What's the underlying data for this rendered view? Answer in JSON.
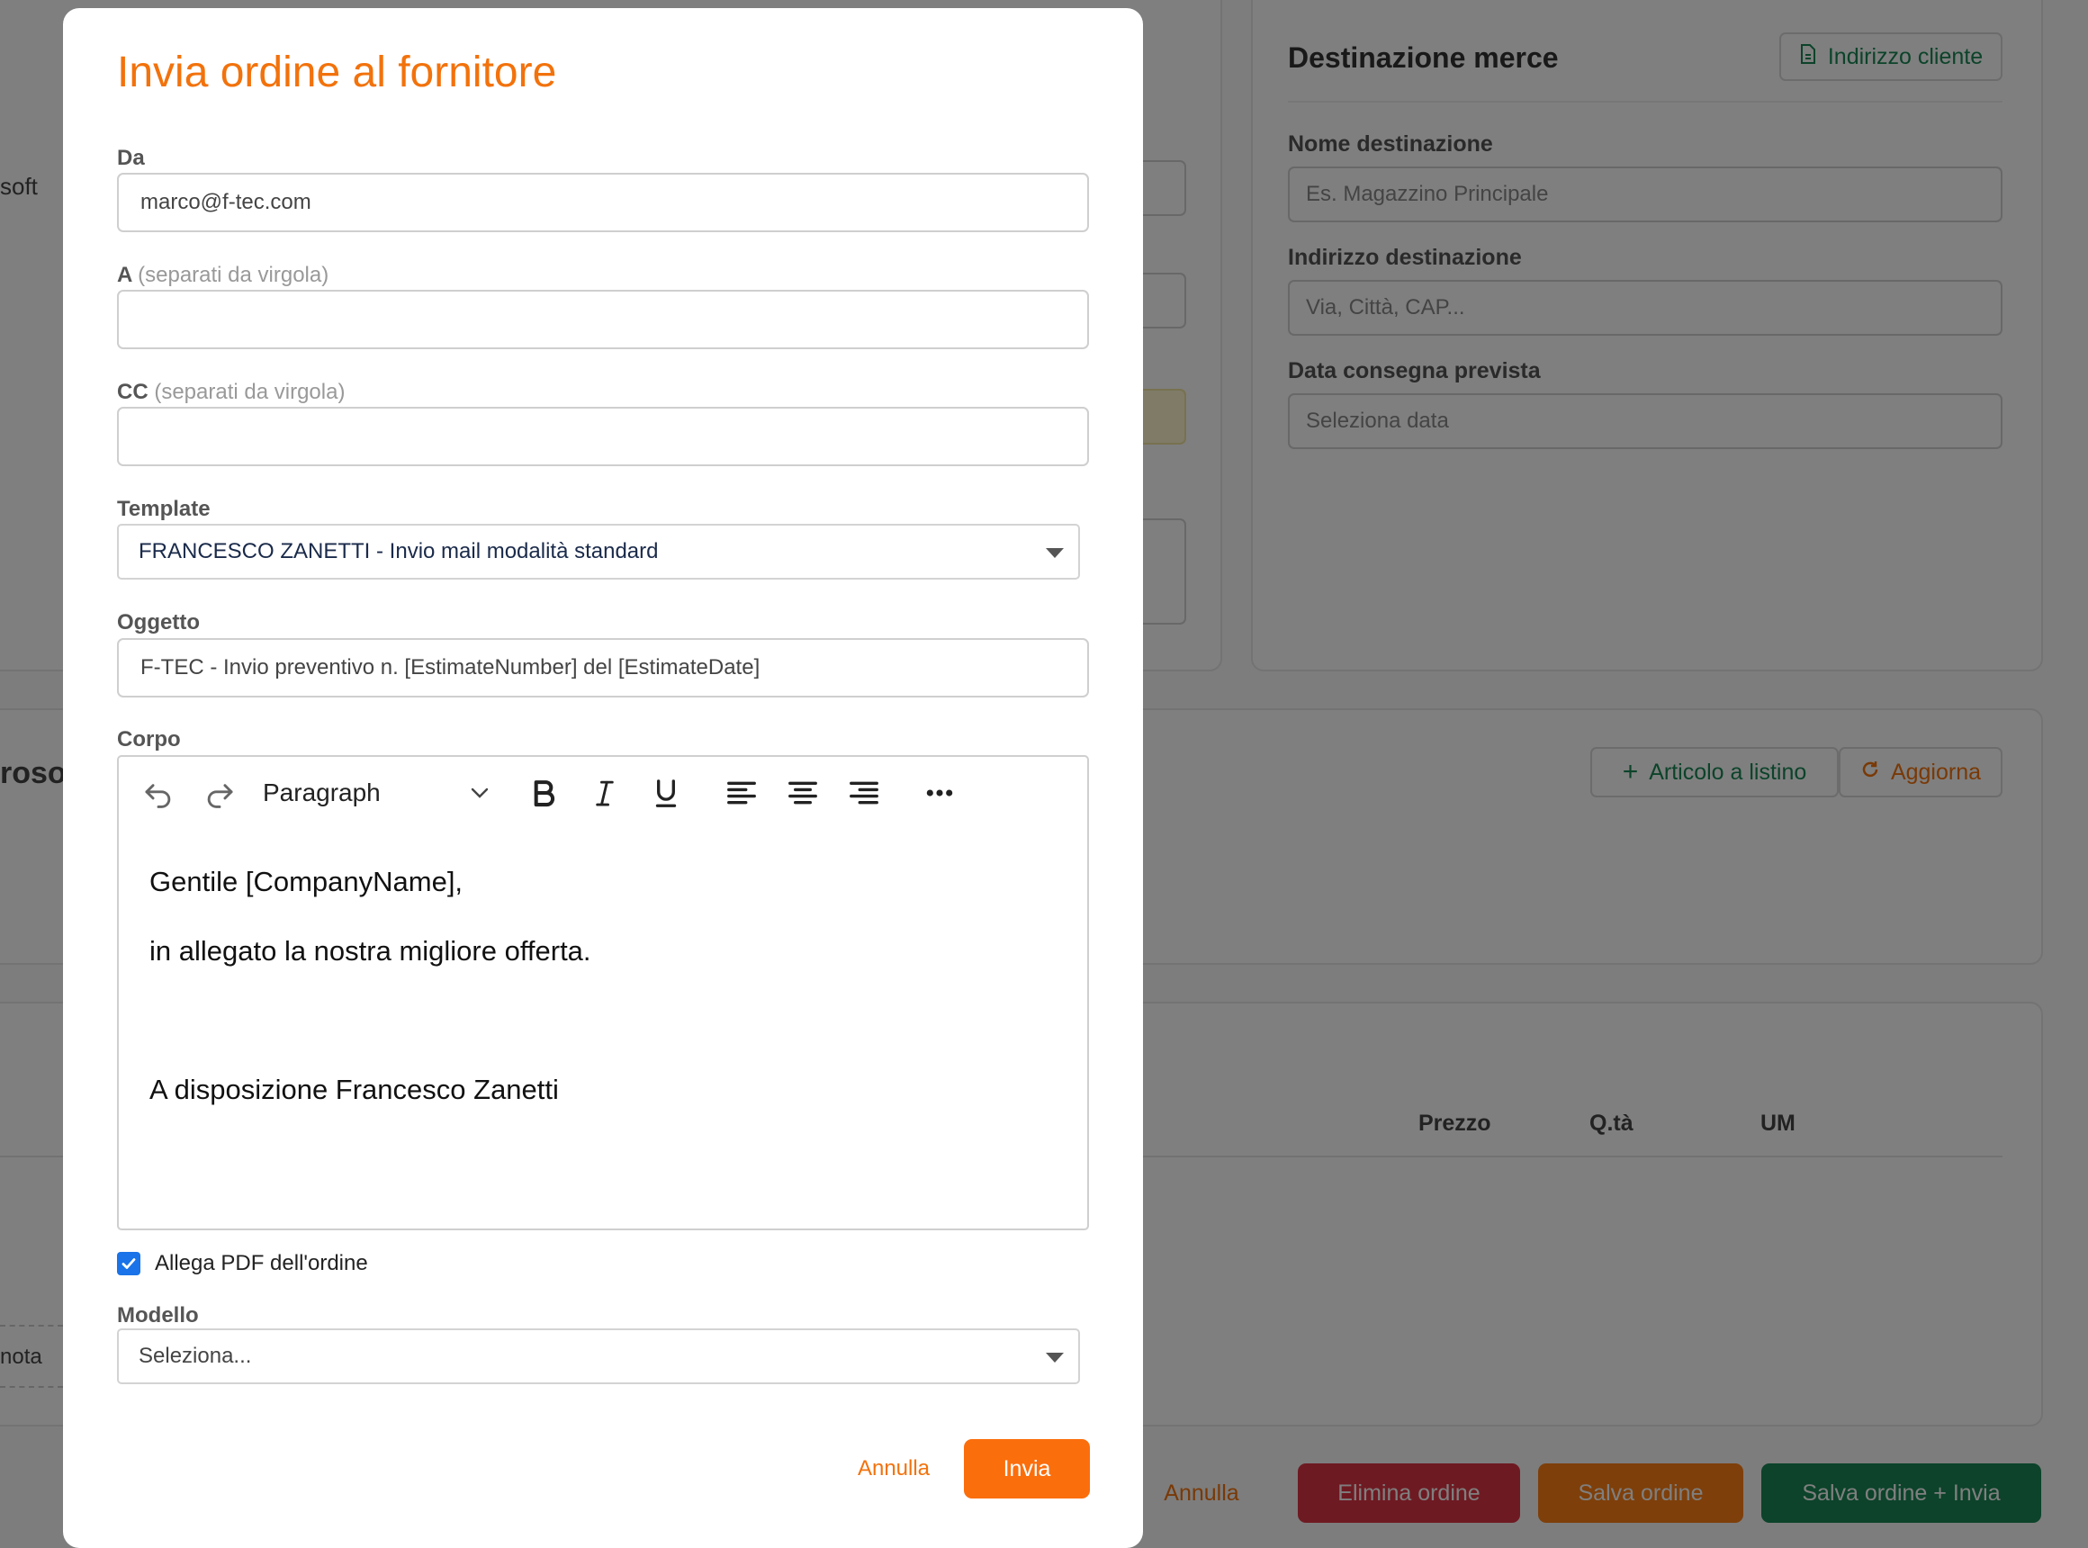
{
  "background": {
    "frag_soft": "soft",
    "frag_rosof": "rosof",
    "frag_nota": "nota",
    "destination": {
      "title": "Destinazione merce",
      "client_address_button": "Indirizzo cliente",
      "name_label": "Nome destinazione",
      "name_placeholder": "Es. Magazzino Principale",
      "address_label": "Indirizzo destinazione",
      "address_placeholder": "Via, Città, CAP...",
      "date_label": "Data consegna prevista",
      "date_placeholder": "Seleziona data"
    },
    "articles": {
      "add_button": "Articolo a listino",
      "refresh_button": "Aggiorna"
    },
    "table_headers": [
      "Prezzo",
      "Q.tà",
      "UM"
    ],
    "footer": {
      "cancel": "Annulla",
      "delete": "Elimina ordine",
      "save": "Salva ordine",
      "save_send": "Salva ordine + Invia"
    },
    "colors": {
      "delete": "#dc3545",
      "save": "#fd7e14",
      "save_send": "#198754",
      "accent": "#f2720c"
    }
  },
  "modal": {
    "title": "Invia ordine al fornitore",
    "from": {
      "label": "Da",
      "value": "marco@f-tec.com"
    },
    "to": {
      "label": "A",
      "hint": "(separati da virgola)",
      "value": ""
    },
    "cc": {
      "label": "CC",
      "hint": "(separati da virgola)",
      "value": ""
    },
    "template": {
      "label": "Template",
      "value": "FRANCESCO ZANETTI - Invio mail modalità standard"
    },
    "subject": {
      "label": "Oggetto",
      "value": "F-TEC - Invio preventivo n. [EstimateNumber] del [EstimateDate]"
    },
    "body": {
      "label": "Corpo",
      "block_format": "Paragraph",
      "paragraphs": [
        "Gentile [CompanyName],",
        "in allegato la nostra migliore offerta.",
        "",
        "A disposizione Francesco Zanetti"
      ],
      "toolbar_icons": [
        "undo-icon",
        "redo-icon",
        "bold-icon",
        "italic-icon",
        "underline-icon",
        "align-left-icon",
        "align-center-icon",
        "align-right-icon",
        "more-icon"
      ]
    },
    "attach_pdf": {
      "label": "Allega PDF dell'ordine",
      "checked": true
    },
    "model": {
      "label": "Modello",
      "placeholder": "Seleziona..."
    },
    "buttons": {
      "cancel": "Annulla",
      "send": "Invia"
    }
  }
}
